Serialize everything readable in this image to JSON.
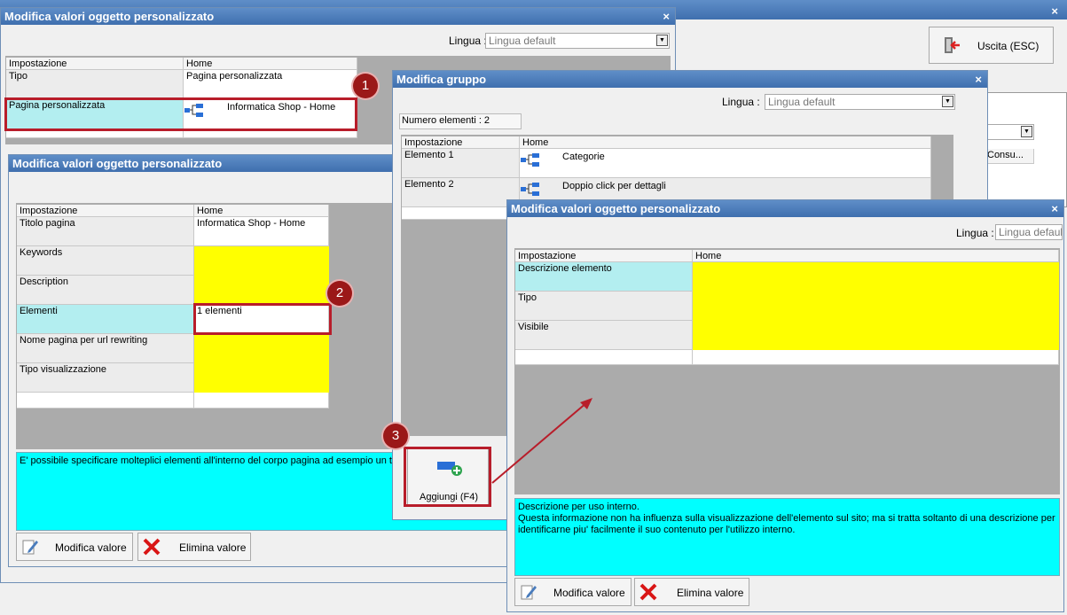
{
  "colors": {
    "titlebar": "#4a7cbc",
    "selected_row": "#b3eef0",
    "yellow_cell": "#ffff00",
    "hint_panel": "#00ffff",
    "badge": "#9b1818"
  },
  "back_window": {
    "exit_button": "Uscita (ESC)",
    "partial_column": "Consu..."
  },
  "win1": {
    "title": "Modifica valori oggetto personalizzato",
    "close": "×",
    "lang_label": "Lingua :",
    "lang_value": "Lingua default",
    "headers": [
      "Impostazione",
      "Home"
    ],
    "rows": [
      {
        "label": "Tipo",
        "value": "Pagina personalizzata"
      },
      {
        "label": "Pagina personalizzata",
        "value": "Informatica Shop - Home"
      }
    ]
  },
  "win2": {
    "title": "Modifica valori oggetto personalizzato",
    "headers": [
      "Impostazione",
      "Home"
    ],
    "rows": [
      {
        "label": "Titolo pagina",
        "value": "Informatica Shop - Home"
      },
      {
        "label": "Keywords",
        "value": ""
      },
      {
        "label": "Description",
        "value": ""
      },
      {
        "label": "Elementi",
        "value": "1 elementi"
      },
      {
        "label": "Nome pagina per url rewriting",
        "value": ""
      },
      {
        "label": "Tipo visualizzazione",
        "value": ""
      }
    ],
    "hint": "E' possibile specificare molteplici elementi all'interno del corpo pagina ad esempio un testo",
    "edit_button": "Modifica valore",
    "delete_button": "Elimina valore"
  },
  "win3": {
    "title": "Modifica gruppo",
    "close": "×",
    "lang_label": "Lingua :",
    "lang_value": "Lingua default",
    "count_label": "Numero elementi : 2",
    "headers": [
      "Impostazione",
      "Home"
    ],
    "rows": [
      {
        "label": "Elemento 1",
        "value": "Categorie"
      },
      {
        "label": "Elemento 2",
        "value": "Doppio click per dettagli"
      }
    ],
    "add_button": "Aggiungi (F4)"
  },
  "win4": {
    "title": "Modifica valori oggetto personalizzato",
    "close": "×",
    "lang_label": "Lingua :",
    "lang_value": "Lingua default",
    "headers": [
      "Impostazione",
      "Home"
    ],
    "rows": [
      {
        "label": "Descrizione elemento",
        "value": ""
      },
      {
        "label": "Tipo",
        "value": ""
      },
      {
        "label": "Visibile",
        "value": ""
      }
    ],
    "hint_title": "Descrizione per uso interno.",
    "hint_body": "Questa informazione non ha influenza sulla visualizzazione dell'elemento sul sito; ma si tratta soltanto di una descrizione per identificarne piu' facilmente il suo contenuto per l'utilizzo interno.",
    "edit_button": "Modifica valore",
    "delete_button": "Elimina valore"
  },
  "badges": [
    "1",
    "2",
    "3"
  ]
}
